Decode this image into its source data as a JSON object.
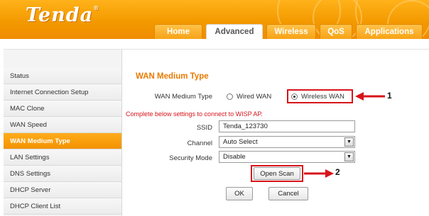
{
  "brand": {
    "logo_text": "Tenda"
  },
  "tabs": [
    {
      "label": "Home",
      "active": false
    },
    {
      "label": "Advanced",
      "active": true
    },
    {
      "label": "Wireless",
      "active": false
    },
    {
      "label": "QoS",
      "active": false
    },
    {
      "label": "Applications",
      "active": false
    }
  ],
  "sidebar": {
    "items": [
      {
        "label": "Status",
        "active": false
      },
      {
        "label": "Internet Connection Setup",
        "active": false
      },
      {
        "label": "MAC Clone",
        "active": false
      },
      {
        "label": "WAN Speed",
        "active": false
      },
      {
        "label": "WAN Medium Type",
        "active": true
      },
      {
        "label": "LAN Settings",
        "active": false
      },
      {
        "label": "DNS Settings",
        "active": false
      },
      {
        "label": "DHCP Server",
        "active": false
      },
      {
        "label": "DHCP Client List",
        "active": false
      }
    ]
  },
  "main": {
    "title": "WAN Medium Type",
    "wan_medium_label": "WAN Medium Type",
    "radio_wired": "Wired WAN",
    "radio_wireless": "Wireless WAN",
    "selected_medium": "Wireless WAN",
    "hint": "Complete below settings to connect to WISP AP.",
    "ssid_label": "SSID",
    "ssid_value": "Tenda_123730",
    "channel_label": "Channel",
    "channel_value": "Auto Select",
    "security_label": "Security Mode",
    "security_value": "Disable",
    "open_scan_label": "Open Scan",
    "ok_label": "OK",
    "cancel_label": "Cancel"
  },
  "annotations": {
    "callout_1": "1",
    "callout_2": "2"
  },
  "colors": {
    "brand_orange": "#f39a00",
    "title_orange": "#e87a00",
    "hint_red": "#d7141a",
    "highlight_red": "#d8141a"
  }
}
